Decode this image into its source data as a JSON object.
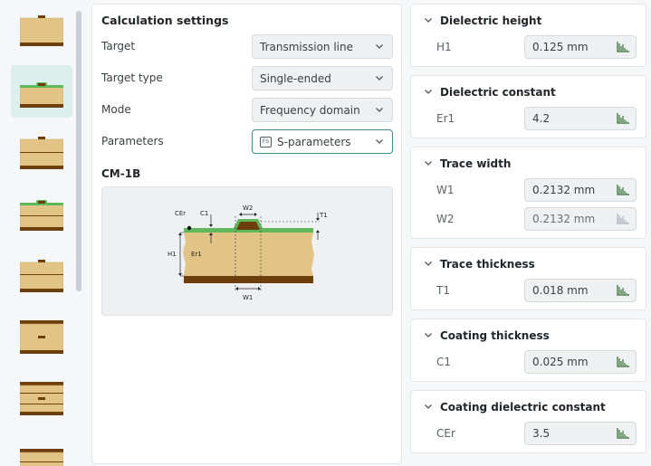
{
  "calc": {
    "title": "Calculation settings",
    "rows": [
      {
        "label": "Target",
        "value": "Transmission line"
      },
      {
        "label": "Target type",
        "value": "Single-ended"
      },
      {
        "label": "Mode",
        "value": "Frequency domain"
      },
      {
        "label": "Parameters",
        "value": "S-parameters",
        "badge": "FS"
      }
    ],
    "model": "CM-1B",
    "diagram_labels": {
      "cer": "CEr",
      "c1": "C1",
      "w2": "W2",
      "t1": "T1",
      "h1": "H1",
      "er1": "Er1",
      "w1": "W1"
    }
  },
  "cards": [
    {
      "title": "Dielectric height",
      "fields": [
        {
          "label": "H1",
          "value": "0.125 mm"
        }
      ]
    },
    {
      "title": "Dielectric constant",
      "fields": [
        {
          "label": "Er1",
          "value": "4.2"
        }
      ]
    },
    {
      "title": "Trace width",
      "fields": [
        {
          "label": "W1",
          "value": "0.2132 mm"
        },
        {
          "label": "W2",
          "value": "0.2132 mm",
          "disabled": true
        }
      ]
    },
    {
      "title": "Trace thickness",
      "fields": [
        {
          "label": "T1",
          "value": "0.018 mm"
        }
      ]
    },
    {
      "title": "Coating thickness",
      "fields": [
        {
          "label": "C1",
          "value": "0.025 mm"
        }
      ]
    },
    {
      "title": "Coating dielectric constant",
      "fields": [
        {
          "label": "CEr",
          "value": "3.5"
        }
      ]
    }
  ],
  "colors": {
    "accent": "#3b8f86",
    "copper": "#6e3f0c",
    "dielectric": "#e2c487",
    "coating": "#5fb85c"
  }
}
